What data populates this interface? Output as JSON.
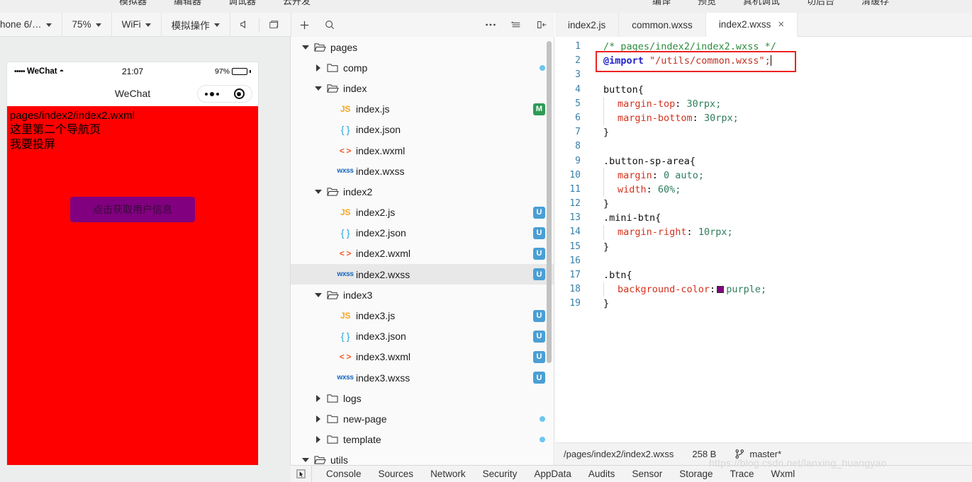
{
  "menu": {
    "left_items": [
      "模拟器",
      "编辑器",
      "调试器",
      "云开发"
    ],
    "right_items": [
      "编译",
      "预览",
      "真机调试",
      "切后台",
      "清缓存"
    ]
  },
  "toolbar": {
    "device": "hone 6/…",
    "zoom": "75%",
    "network": "WiFi",
    "simulate": "模拟操作",
    "mute_icon": "speaker-icon",
    "window_icon": "window-icon",
    "add_icon": "plus-icon",
    "search_icon": "search-icon",
    "more_icon": "ellipsis-icon",
    "sort_icon": "sort-icon",
    "collapse_icon": "collapse-panel-icon"
  },
  "simulator": {
    "status": {
      "signal_dots": "•••••",
      "carrier": "WeChat",
      "wifi": "wifi-icon",
      "time": "21:07",
      "battery_pct": "97%"
    },
    "nav_title": "WeChat",
    "capsule": {
      "dots_icon": "more-dots-icon",
      "target_icon": "target-circle-icon"
    },
    "page": {
      "background": "#ff0000",
      "lines": [
        "pages/index2/index2.wxml",
        "这里第二个导航页",
        "我要投屏"
      ],
      "button_label": "点击获取用户信息",
      "button_color": "#800080"
    }
  },
  "tree": [
    {
      "indent": 0,
      "twisty": "down",
      "icon": "folder-open",
      "label": "pages",
      "badge": "",
      "dot": false
    },
    {
      "indent": 1,
      "twisty": "right",
      "icon": "folder",
      "label": "comp",
      "badge": "",
      "dot": true
    },
    {
      "indent": 1,
      "twisty": "down",
      "icon": "folder-open",
      "label": "index",
      "badge": "",
      "dot": false
    },
    {
      "indent": 2,
      "twisty": "none",
      "icon": "js",
      "label": "index.js",
      "badge": "M",
      "dot": false
    },
    {
      "indent": 2,
      "twisty": "none",
      "icon": "json",
      "label": "index.json",
      "badge": "",
      "dot": false
    },
    {
      "indent": 2,
      "twisty": "none",
      "icon": "wxml",
      "label": "index.wxml",
      "badge": "",
      "dot": false
    },
    {
      "indent": 2,
      "twisty": "none",
      "icon": "wxss",
      "label": "index.wxss",
      "badge": "",
      "dot": false
    },
    {
      "indent": 1,
      "twisty": "down",
      "icon": "folder-open",
      "label": "index2",
      "badge": "",
      "dot": false
    },
    {
      "indent": 2,
      "twisty": "none",
      "icon": "js",
      "label": "index2.js",
      "badge": "U",
      "dot": false
    },
    {
      "indent": 2,
      "twisty": "none",
      "icon": "json",
      "label": "index2.json",
      "badge": "U",
      "dot": false
    },
    {
      "indent": 2,
      "twisty": "none",
      "icon": "wxml",
      "label": "index2.wxml",
      "badge": "U",
      "dot": false
    },
    {
      "indent": 2,
      "twisty": "none",
      "icon": "wxss",
      "label": "index2.wxss",
      "badge": "U",
      "dot": false,
      "selected": true
    },
    {
      "indent": 1,
      "twisty": "down",
      "icon": "folder-open",
      "label": "index3",
      "badge": "",
      "dot": false
    },
    {
      "indent": 2,
      "twisty": "none",
      "icon": "js",
      "label": "index3.js",
      "badge": "U",
      "dot": false
    },
    {
      "indent": 2,
      "twisty": "none",
      "icon": "json",
      "label": "index3.json",
      "badge": "U",
      "dot": false
    },
    {
      "indent": 2,
      "twisty": "none",
      "icon": "wxml",
      "label": "index3.wxml",
      "badge": "U",
      "dot": false
    },
    {
      "indent": 2,
      "twisty": "none",
      "icon": "wxss",
      "label": "index3.wxss",
      "badge": "U",
      "dot": false
    },
    {
      "indent": 1,
      "twisty": "right",
      "icon": "folder",
      "label": "logs",
      "badge": "",
      "dot": false
    },
    {
      "indent": 1,
      "twisty": "right",
      "icon": "folder",
      "label": "new-page",
      "badge": "",
      "dot": true
    },
    {
      "indent": 1,
      "twisty": "right",
      "icon": "folder",
      "label": "template",
      "badge": "",
      "dot": true
    },
    {
      "indent": 0,
      "twisty": "down",
      "icon": "folder-open",
      "label": "utils",
      "badge": "",
      "dot": false
    }
  ],
  "editor": {
    "tabs": [
      {
        "label": "index2.js",
        "active": false,
        "closable": false
      },
      {
        "label": "common.wxss",
        "active": false,
        "closable": false
      },
      {
        "label": "index2.wxss",
        "active": true,
        "closable": true
      }
    ],
    "close_icon": "close-icon",
    "lines": [
      {
        "n": "1",
        "text": "/* pages/index2/index2.wxss */"
      },
      {
        "n": "2",
        "text": "@import \"/utils/common.wxss\";"
      },
      {
        "n": "3",
        "text": ""
      },
      {
        "n": "4",
        "text": "button{"
      },
      {
        "n": "5",
        "text": "  margin-top: 30rpx;"
      },
      {
        "n": "6",
        "text": "  margin-bottom: 30rpx;"
      },
      {
        "n": "7",
        "text": "}"
      },
      {
        "n": "8",
        "text": ""
      },
      {
        "n": "9",
        "text": ".button-sp-area{"
      },
      {
        "n": "10",
        "text": "  margin: 0 auto;"
      },
      {
        "n": "11",
        "text": "  width: 60%;"
      },
      {
        "n": "12",
        "text": "}"
      },
      {
        "n": "13",
        "text": ".mini-btn{"
      },
      {
        "n": "14",
        "text": "  margin-right: 10rpx;"
      },
      {
        "n": "15",
        "text": "}"
      },
      {
        "n": "16",
        "text": ""
      },
      {
        "n": "17",
        "text": ".btn{"
      },
      {
        "n": "18",
        "text": "  background-color: purple;"
      },
      {
        "n": "19",
        "text": "}"
      }
    ],
    "highlight_color": "#ee2222"
  },
  "status_bar": {
    "path": "/pages/index2/index2.wxss",
    "size": "258 B",
    "branch_icon": "branch-icon",
    "branch": "master*"
  },
  "devtools": {
    "picker_icon": "inspect-picker-icon",
    "tabs": [
      "Console",
      "Sources",
      "Network",
      "Security",
      "AppData",
      "Audits",
      "Sensor",
      "Storage",
      "Trace",
      "Wxml"
    ]
  },
  "watermark": "https://blog.csdn.net/lanxing_huangyao"
}
